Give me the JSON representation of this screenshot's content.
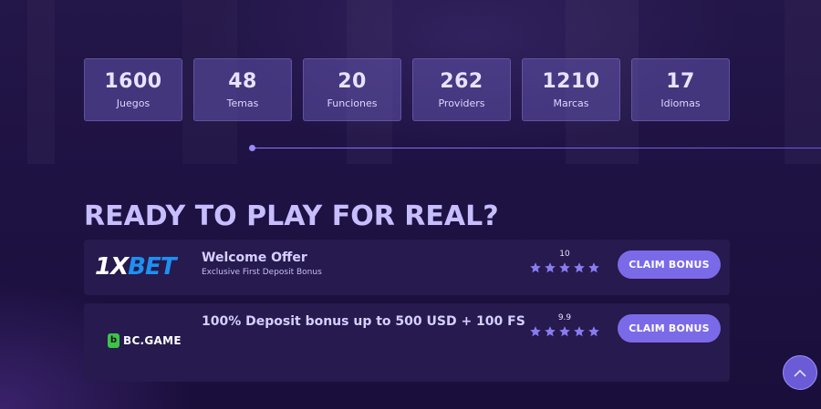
{
  "stats": [
    {
      "value": "1600",
      "label": "Juegos"
    },
    {
      "value": "48",
      "label": "Temas"
    },
    {
      "value": "20",
      "label": "Funciones"
    },
    {
      "value": "262",
      "label": "Providers"
    },
    {
      "value": "1210",
      "label": "Marcas"
    },
    {
      "value": "17",
      "label": "Idiomas"
    }
  ],
  "headline": "READY TO PLAY FOR REAL?",
  "offers": [
    {
      "logo_parts": [
        "1X",
        "BET"
      ],
      "title": "Welcome Offer",
      "subtitle": "Exclusive First Deposit Bonus",
      "rating": "10",
      "stars": 5,
      "button": "CLAIM BONUS"
    },
    {
      "logo_badge": "b",
      "logo_text": "BC.GAME",
      "title": "100% Deposit bonus up to 500 USD + 100 FS",
      "rating": "9.9",
      "stars": 5,
      "button": "CLAIM BONUS"
    }
  ],
  "colors": {
    "accent": "#7b6ae8",
    "star": "#8a7cf0",
    "headline": "#c7bdff"
  },
  "icons": {
    "scroll_top": "chevron-up-icon",
    "star": "star-icon"
  }
}
